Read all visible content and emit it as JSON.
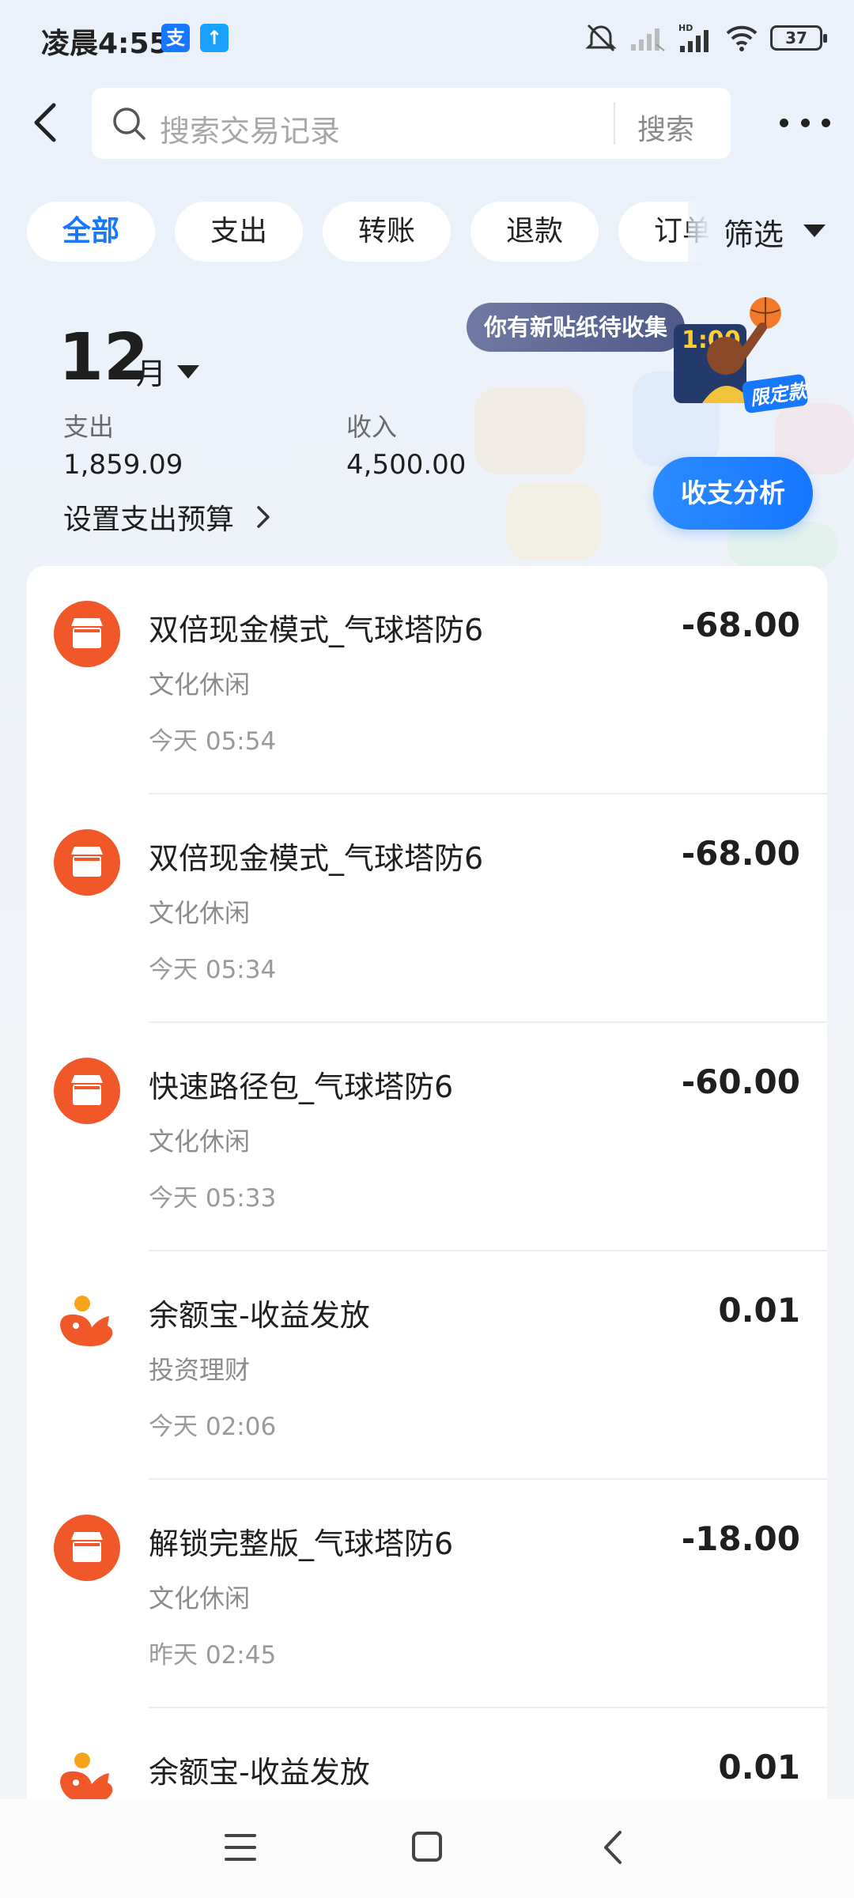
{
  "status_bar": {
    "time": "凌晨4:55",
    "badge_alipay": "支",
    "badge_upload": "↑",
    "battery": "37",
    "signal_label": "HD"
  },
  "search": {
    "placeholder": "搜索交易记录",
    "button": "搜索"
  },
  "filters": {
    "chips": [
      "全部",
      "支出",
      "转账",
      "退款",
      "订单"
    ],
    "active": "全部",
    "filter_label": "筛选"
  },
  "summary": {
    "month_number": "12",
    "month_unit": "月",
    "expense_label": "支出",
    "expense_value": "1,859.09",
    "income_label": "收入",
    "income_value": "4,500.00",
    "budget_link": "设置支出预算",
    "sticker_bubble": "你有新贴纸待收集",
    "sticker_tag": "限定款",
    "analysis_button": "收支分析"
  },
  "transactions": [
    {
      "title": "双倍现金模式_气球塔防6",
      "category": "文化休闲",
      "time": "今天 05:54",
      "amount": "-68.00",
      "icon": "shop-icon"
    },
    {
      "title": "双倍现金模式_气球塔防6",
      "category": "文化休闲",
      "time": "今天 05:34",
      "amount": "-68.00",
      "icon": "shop-icon"
    },
    {
      "title": "快速路径包_气球塔防6",
      "category": "文化休闲",
      "time": "今天 05:33",
      "amount": "-60.00",
      "icon": "shop-icon"
    },
    {
      "title": "余额宝-收益发放",
      "category": "投资理财",
      "time": "今天 02:06",
      "amount": "0.01",
      "icon": "yuebao-icon"
    },
    {
      "title": "解锁完整版_气球塔防6",
      "category": "文化休闲",
      "time": "昨天 02:45",
      "amount": "-18.00",
      "icon": "shop-icon"
    },
    {
      "title": "余额宝-收益发放",
      "category": "",
      "time": "",
      "amount": "0.01",
      "icon": "yuebao-icon"
    }
  ],
  "colors": {
    "accent": "#1677ff",
    "shop_icon": "#f0582a",
    "yuebao_icon": "#f0582a"
  }
}
